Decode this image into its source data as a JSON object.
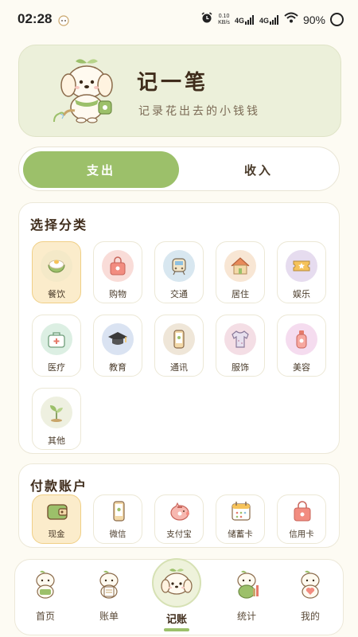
{
  "status_bar": {
    "time": "02:28",
    "speed_value": "0.10",
    "speed_unit": "KB/s",
    "net1": "4G",
    "net2": "4G",
    "battery": "90%"
  },
  "header": {
    "title": "记一笔",
    "subtitle": "记录花出去的小钱钱"
  },
  "type_switch": {
    "expense": "支出",
    "income": "收入",
    "selected": "expense"
  },
  "categories": {
    "title": "选择分类",
    "items": [
      {
        "label": "餐饮",
        "icon": "rice-bowl-icon",
        "bg": "#f4e9c8",
        "selected": true
      },
      {
        "label": "购物",
        "icon": "shopping-bag-icon",
        "bg": "#f9dcd8"
      },
      {
        "label": "交通",
        "icon": "train-icon",
        "bg": "#d8e7f0"
      },
      {
        "label": "居住",
        "icon": "house-icon",
        "bg": "#f8e6d4"
      },
      {
        "label": "娱乐",
        "icon": "ticket-icon",
        "bg": "#e6dcef"
      },
      {
        "label": "医疗",
        "icon": "medical-kit-icon",
        "bg": "#dcefe3"
      },
      {
        "label": "教育",
        "icon": "graduation-cap-icon",
        "bg": "#dae3f2"
      },
      {
        "label": "通讯",
        "icon": "phone-icon",
        "bg": "#efe6d8"
      },
      {
        "label": "服饰",
        "icon": "shirt-icon",
        "bg": "#f4dee5"
      },
      {
        "label": "美容",
        "icon": "perfume-icon",
        "bg": "#f5dcef"
      },
      {
        "label": "其他",
        "icon": "sprout-icon",
        "bg": "#eef0e0"
      }
    ]
  },
  "accounts": {
    "title": "付款账户",
    "items": [
      {
        "label": "现金",
        "icon": "wallet-icon",
        "selected": true
      },
      {
        "label": "微信",
        "icon": "phone-icon"
      },
      {
        "label": "支付宝",
        "icon": "piggy-bank-icon"
      },
      {
        "label": "储蓄卡",
        "icon": "calendar-icon"
      },
      {
        "label": "信用卡",
        "icon": "shopping-bag-icon"
      }
    ]
  },
  "nav": {
    "home": "首页",
    "bills": "账单",
    "record": "记账",
    "stats": "统计",
    "me": "我的"
  },
  "colors": {
    "accent_green": "#9cc06a",
    "selected_tile": "#fbeccb",
    "background": "#fdfbf3"
  }
}
